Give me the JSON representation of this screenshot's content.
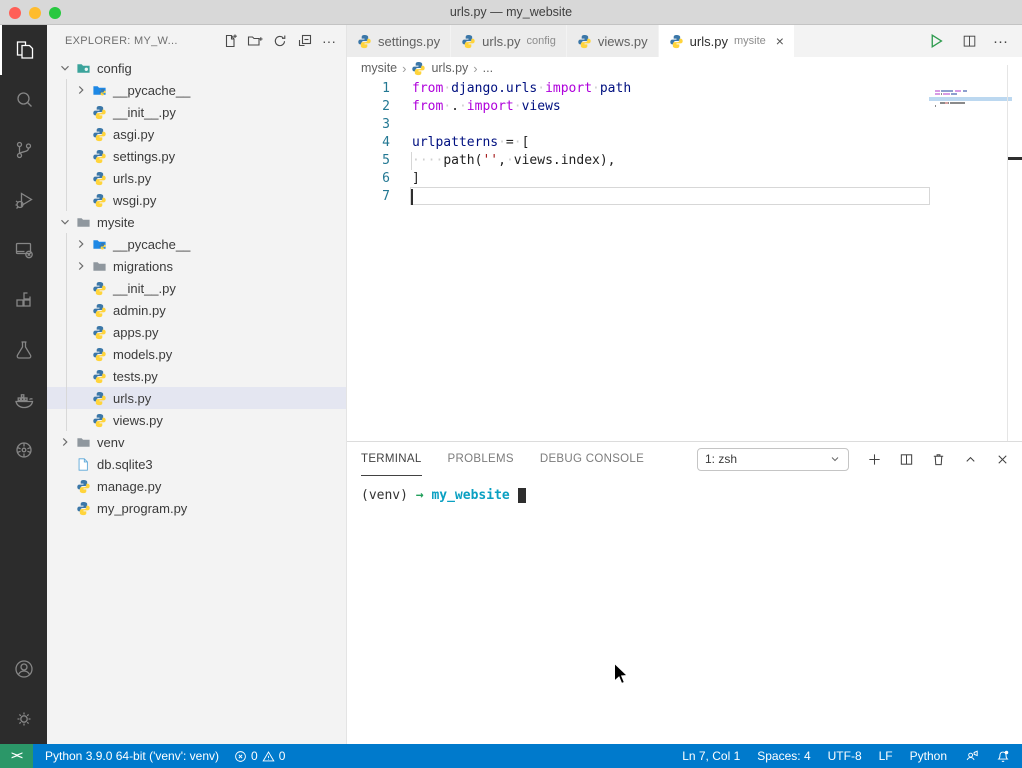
{
  "window": {
    "title": "urls.py — my_website"
  },
  "activity_bar": {
    "items": [
      "explorer",
      "search",
      "source-control",
      "run-and-debug",
      "remote-explorer",
      "extensions",
      "testing",
      "docker",
      "kubernetes"
    ],
    "active_item": "explorer",
    "bottom_items": [
      "account",
      "settings"
    ]
  },
  "sidebar": {
    "header": "EXPLORER: MY_W...",
    "actions": [
      "new-file",
      "new-folder",
      "refresh-explorer",
      "collapse-folders",
      "more-actions"
    ],
    "guides": [
      {
        "row_start": 1,
        "rows": 6
      },
      {
        "row_start": 8,
        "rows": 9
      }
    ],
    "tree": [
      {
        "label": "config",
        "indent": 0,
        "chevron": "down",
        "icon": "folder-config"
      },
      {
        "label": "__pycache__",
        "indent": 1,
        "chevron": "right",
        "icon": "folder-blue"
      },
      {
        "label": "__init__.py",
        "indent": 1,
        "icon": "python"
      },
      {
        "label": "asgi.py",
        "indent": 1,
        "icon": "python"
      },
      {
        "label": "settings.py",
        "indent": 1,
        "icon": "python"
      },
      {
        "label": "urls.py",
        "indent": 1,
        "icon": "python"
      },
      {
        "label": "wsgi.py",
        "indent": 1,
        "icon": "python"
      },
      {
        "label": "mysite",
        "indent": 0,
        "chevron": "down",
        "icon": "folder-gray"
      },
      {
        "label": "__pycache__",
        "indent": 1,
        "chevron": "right",
        "icon": "folder-blue"
      },
      {
        "label": "migrations",
        "indent": 1,
        "chevron": "right",
        "icon": "folder-gray"
      },
      {
        "label": "__init__.py",
        "indent": 1,
        "icon": "python"
      },
      {
        "label": "admin.py",
        "indent": 1,
        "icon": "python"
      },
      {
        "label": "apps.py",
        "indent": 1,
        "icon": "python"
      },
      {
        "label": "models.py",
        "indent": 1,
        "icon": "python"
      },
      {
        "label": "tests.py",
        "indent": 1,
        "icon": "python"
      },
      {
        "label": "urls.py",
        "indent": 1,
        "icon": "python",
        "selected": true
      },
      {
        "label": "views.py",
        "indent": 1,
        "icon": "python"
      },
      {
        "label": "venv",
        "indent": 0,
        "chevron": "right",
        "icon": "folder-gray"
      },
      {
        "label": "db.sqlite3",
        "indent": 0,
        "icon": "file"
      },
      {
        "label": "manage.py",
        "indent": 0,
        "icon": "python"
      },
      {
        "label": "my_program.py",
        "indent": 0,
        "icon": "python"
      }
    ]
  },
  "editor": {
    "tabs": [
      {
        "label": "settings.py"
      },
      {
        "label": "urls.py",
        "hint": "config"
      },
      {
        "label": "views.py"
      },
      {
        "label": "urls.py",
        "hint": "mysite",
        "active": true,
        "closable": true
      }
    ],
    "actions": [
      "run-python-file",
      "split-editor",
      "more-actions"
    ],
    "breadcrumb": [
      {
        "label": "mysite"
      },
      {
        "label": "urls.py",
        "icon": "python"
      },
      {
        "label": "..."
      }
    ],
    "cursor": {
      "line": 7,
      "col": 1
    },
    "code": {
      "lines": [
        {
          "n": "1",
          "tokens": [
            [
              "kw",
              "from"
            ],
            [
              "sp",
              " "
            ],
            [
              "id",
              "django.urls"
            ],
            [
              "sp",
              " "
            ],
            [
              "kw",
              "import"
            ],
            [
              "sp",
              " "
            ],
            [
              "id",
              "path"
            ]
          ]
        },
        {
          "n": "2",
          "tokens": [
            [
              "kw",
              "from"
            ],
            [
              "sp",
              " "
            ],
            [
              "def",
              "."
            ],
            [
              "sp",
              " "
            ],
            [
              "kw",
              "import"
            ],
            [
              "sp",
              " "
            ],
            [
              "id",
              "views"
            ]
          ]
        },
        {
          "n": "3",
          "tokens": []
        },
        {
          "n": "4",
          "tokens": [
            [
              "id",
              "urlpatterns"
            ],
            [
              "sp",
              " "
            ],
            [
              "def",
              "="
            ],
            [
              "sp",
              " "
            ],
            [
              "def",
              "["
            ]
          ]
        },
        {
          "n": "5",
          "tokens": [
            [
              "ws",
              "    "
            ],
            [
              "def",
              "path("
            ],
            [
              "str",
              "''"
            ],
            [
              "def",
              ","
            ],
            [
              "sp",
              " "
            ],
            [
              "def",
              "views.index),"
            ]
          ]
        },
        {
          "n": "6",
          "tokens": [
            [
              "def",
              "]"
            ]
          ]
        },
        {
          "n": "7",
          "tokens": []
        }
      ]
    }
  },
  "panel": {
    "tabs": [
      {
        "label": "TERMINAL",
        "active": true
      },
      {
        "label": "PROBLEMS"
      },
      {
        "label": "DEBUG CONSOLE"
      }
    ],
    "shell_select": "1: zsh",
    "actions": [
      "new-terminal",
      "split-terminal",
      "kill-terminal",
      "maximize-panel",
      "close-panel"
    ],
    "terminal_line": [
      [
        "fg",
        "(venv) "
      ],
      [
        "green",
        "→"
      ],
      [
        "fg",
        "  "
      ],
      [
        "cyan",
        "my_website"
      ]
    ]
  },
  "status_bar": {
    "remote_glyph": "><",
    "python_interpreter": "Python 3.9.0 64-bit ('venv': venv)",
    "errors": "0",
    "warnings": "0",
    "right": [
      {
        "name": "cursor-position",
        "label": "Ln 7, Col 1"
      },
      {
        "name": "indentation",
        "label": "Spaces: 4"
      },
      {
        "name": "encoding",
        "label": "UTF-8"
      },
      {
        "name": "eol",
        "label": "LF"
      },
      {
        "name": "language-mode",
        "label": "Python"
      }
    ]
  },
  "colors": {
    "statusbar_bg": "#007acc",
    "remote_bg": "#2b9768",
    "activitybar_bg": "#2c2c2c",
    "sidebar_bg": "#f3f3f3",
    "selected_row_bg": "#e4e6f1",
    "keyword": "#af00db",
    "identifier": "#001080",
    "string": "#a31515",
    "line_number": "#237893",
    "terminal_green": "#23a05c",
    "terminal_cyan": "#0aa0c2",
    "python_icon_blue": "#3b77a8",
    "python_icon_yellow": "#ffd43b"
  }
}
